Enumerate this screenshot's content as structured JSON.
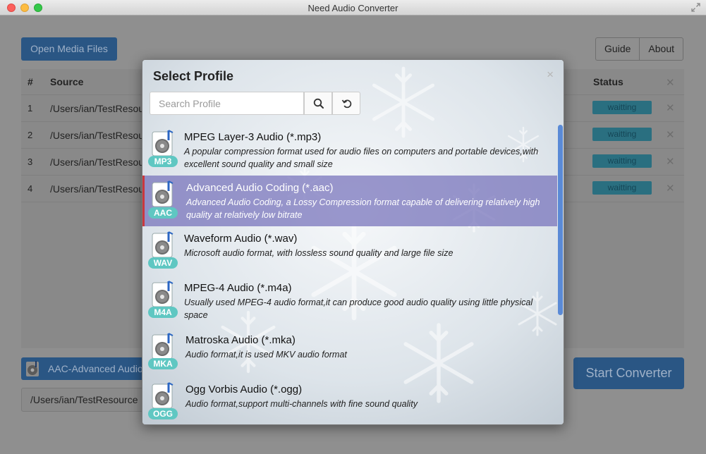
{
  "window": {
    "title": "Need Audio Converter"
  },
  "toolbar": {
    "open_label": "Open Media Files",
    "guide_label": "Guide",
    "about_label": "About"
  },
  "table": {
    "headers": {
      "num": "#",
      "source": "Source",
      "status": "Status"
    },
    "rows": [
      {
        "num": "1",
        "source": "/Users/ian/TestResou",
        "status": "waitting"
      },
      {
        "num": "2",
        "source": "/Users/ian/TestResou",
        "status": "waitting"
      },
      {
        "num": "3",
        "source": "/Users/ian/TestResou",
        "status": "waitting"
      },
      {
        "num": "4",
        "source": "/Users/ian/TestResou",
        "status": "waitting"
      }
    ]
  },
  "bottom": {
    "profile_label": "AAC-Advanced Audio",
    "output_path": "/Users/ian/TestResource",
    "start_label": "Start Converter"
  },
  "modal": {
    "title": "Select Profile",
    "close": "×",
    "search_placeholder": "Search Profile",
    "selected_index": 1,
    "items": [
      {
        "badge": "MP3",
        "name": "MPEG Layer-3 Audio (*.mp3)",
        "desc": "A popular compression format used for audio files on computers and portable devices,with excellent sound quality and small size"
      },
      {
        "badge": "AAC",
        "name": "Advanced Audio Coding (*.aac)",
        "desc": "Advanced Audio Coding, a Lossy Compression format capable of delivering relatively high quality at relatively low bitrate"
      },
      {
        "badge": "WAV",
        "name": "Waveform Audio (*.wav)",
        "desc": "Microsoft audio format, with lossless sound quality and large file size"
      },
      {
        "badge": "M4A",
        "name": "MPEG-4 Audio (*.m4a)",
        "desc": "Usually used MPEG-4 audio format,it can produce good audio quality using little physical space"
      },
      {
        "badge": "MKA",
        "name": "Matroska Audio (*.mka)",
        "desc": "Audio format,it is used MKV audio format"
      },
      {
        "badge": "OGG",
        "name": "Ogg Vorbis Audio (*.ogg)",
        "desc": "Audio format,support multi-channels with fine sound quality"
      }
    ]
  },
  "colors": {
    "accent_blue": "#2f6aa8",
    "badge_teal": "#5fc7c2",
    "selected_row": "#7470ba",
    "selected_marker": "#c9383e",
    "status_badge": "#2a6f80"
  }
}
